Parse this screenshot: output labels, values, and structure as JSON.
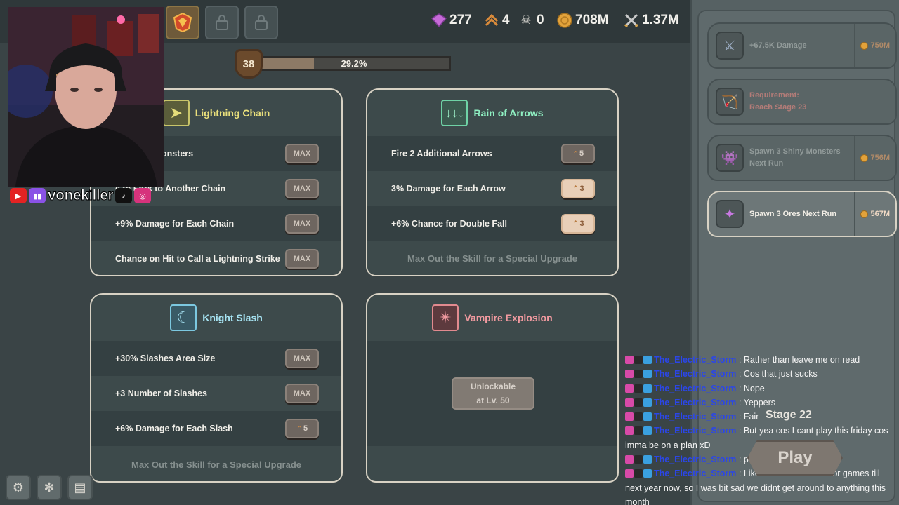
{
  "resources": {
    "gems": "277",
    "rank": "4",
    "kills": "0",
    "coins": "708M",
    "power": "1.37M"
  },
  "player": {
    "level": "38",
    "xp_percent_label": "29.2%",
    "xp_fraction": 0.292
  },
  "skills": {
    "lightning": {
      "title": "Lightning Chain",
      "rows": [
        {
          "label": "dditional Monsters",
          "button": "MAX"
        },
        {
          "label": "e to Fork to Another Chain",
          "button": "MAX"
        },
        {
          "label": "+9% Damage for Each Chain",
          "button": "MAX"
        },
        {
          "label": "Chance on Hit to Call a Lightning Strike",
          "button": "MAX"
        }
      ]
    },
    "arrows": {
      "title": "Rain of Arrows",
      "rows": [
        {
          "label": "Fire 2 Additional Arrows",
          "button": "5"
        },
        {
          "label": "3% Damage for Each Arrow",
          "button": "3"
        },
        {
          "label": "+6% Chance for Double Fall",
          "button": "3"
        }
      ],
      "footer": "Max Out the Skill for a Special Upgrade"
    },
    "knight": {
      "title": "Knight Slash",
      "rows": [
        {
          "label": "+30% Slashes Area Size",
          "button": "MAX"
        },
        {
          "label": "+3 Number of Slashes",
          "button": "MAX"
        },
        {
          "label": "+6% Damage for Each Slash",
          "button": "5"
        }
      ],
      "footer": "Max Out the Skill for a Special Upgrade"
    },
    "vampire": {
      "title": "Vampire Explosion",
      "unlock_line1": "Unlockable",
      "unlock_line2": "at Lv. 50"
    }
  },
  "upgrades": [
    {
      "label": "+67.5K Damage",
      "cost": "750M",
      "icon": "sword-icon"
    },
    {
      "label1": "Requirement:",
      "label2": "Reach Stage 23",
      "icon": "bow-icon"
    },
    {
      "label1": "Spawn 3 Shiny Monsters",
      "label2": "Next Run",
      "cost": "756M",
      "icon": "monster-icon"
    },
    {
      "label": "Spawn 3 Ores Next Run",
      "cost": "567M",
      "icon": "crystal-icon"
    }
  ],
  "stream": {
    "handle": "vonekiller"
  },
  "chat": [
    {
      "user": "The_Electric_Storm",
      "message": "Rather than leave me on read"
    },
    {
      "user": "The_Electric_Storm",
      "message": "Cos that just sucks"
    },
    {
      "user": "The_Electric_Storm",
      "message": "Nope"
    },
    {
      "user": "The_Electric_Storm",
      "message": "Yeppers"
    },
    {
      "user": "The_Electric_Storm",
      "message": "Fair"
    },
    {
      "user": "The_Electric_Storm",
      "message": "But yea cos I cant play this friday cos imma be on a plan xD"
    },
    {
      "user": "The_Electric_Storm",
      "message": "plane"
    },
    {
      "user": "The_Electric_Storm",
      "message": "Like I wont be around for games till next year now, so I was bit sad we didnt get around to anything this month"
    }
  ],
  "stage": {
    "label": "Stage 22",
    "play": "Play"
  },
  "colors": {
    "background": "#3a4446",
    "panel": "#3d4a4b",
    "gold": "#e2a23b",
    "chat_user": "#2b46e8"
  }
}
